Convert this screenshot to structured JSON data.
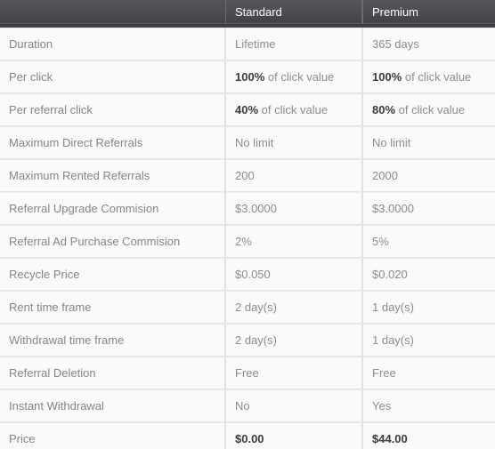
{
  "table": {
    "columns": [
      {
        "key": "feature",
        "label": ""
      },
      {
        "key": "standard",
        "label": "Standard"
      },
      {
        "key": "premium",
        "label": "Premium"
      }
    ],
    "rows": [
      {
        "feature": "Duration",
        "standard": "Lifetime",
        "premium": "365 days",
        "standard_bold": "",
        "premium_bold": ""
      },
      {
        "feature": "Per click",
        "standard_bold": "100%",
        "standard": " of click value",
        "premium_bold": "100%",
        "premium": " of click value"
      },
      {
        "feature": "Per referral click",
        "standard_bold": "40%",
        "standard": " of click value",
        "premium_bold": "80%",
        "premium": " of click value"
      },
      {
        "feature": "Maximum Direct Referrals",
        "standard": "No limit",
        "premium": "No limit",
        "standard_bold": "",
        "premium_bold": ""
      },
      {
        "feature": "Maximum Rented Referrals",
        "standard": "200",
        "premium": "2000",
        "standard_bold": "",
        "premium_bold": ""
      },
      {
        "feature": "Referral Upgrade Commision",
        "standard": "$3.0000",
        "premium": "$3.0000",
        "standard_bold": "",
        "premium_bold": ""
      },
      {
        "feature": "Referral Ad Purchase Commision",
        "standard": "2%",
        "premium": "5%",
        "standard_bold": "",
        "premium_bold": ""
      },
      {
        "feature": "Recycle Price",
        "standard": "$0.050",
        "premium": "$0.020",
        "standard_bold": "",
        "premium_bold": ""
      },
      {
        "feature": "Rent time frame",
        "standard": "2 day(s)",
        "premium": "1 day(s)",
        "standard_bold": "",
        "premium_bold": ""
      },
      {
        "feature": "Withdrawal time frame",
        "standard": "2 day(s)",
        "premium": "1 day(s)",
        "standard_bold": "",
        "premium_bold": ""
      },
      {
        "feature": "Referral Deletion",
        "standard": "Free",
        "premium": "Free",
        "standard_bold": "",
        "premium_bold": ""
      },
      {
        "feature": "Instant Withdrawal",
        "standard": "No",
        "premium": "Yes",
        "standard_bold": "",
        "premium_bold": ""
      },
      {
        "feature": "Price",
        "standard": "",
        "premium": "",
        "standard_bold": "$0.00",
        "premium_bold": "$44.00"
      }
    ]
  },
  "colors": {
    "header_bg_top": "#55565b",
    "header_bg_bottom": "#414247",
    "header_text": "#ffffff",
    "cell_bg": "#fafafa",
    "cell_text": "#8b8b93",
    "cell_border": "#e2e2e2",
    "emphasis_text": "#3b3b42"
  }
}
